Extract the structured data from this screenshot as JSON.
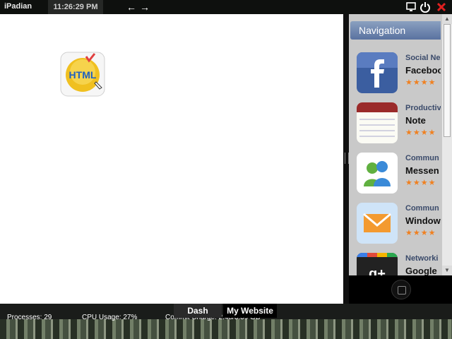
{
  "topbar": {
    "brand": "iPadian",
    "clock": "11:26:29 PM",
    "back_icon": "left-arrow-icon",
    "forward_icon": "right-arrow-icon"
  },
  "desktop": {
    "html_app_label": "HTML"
  },
  "navigation": {
    "title": "Navigation",
    "items": [
      {
        "category": "Social Ne",
        "name": "Faceboo",
        "stars": "★★★★"
      },
      {
        "category": "Productiv",
        "name": "Note",
        "stars": "★★★★"
      },
      {
        "category": "Commun",
        "name": "Messen",
        "stars": "★★★★"
      },
      {
        "category": "Commun",
        "name": "Window",
        "stars": "★★★★"
      },
      {
        "category": "Networki",
        "name": "Google",
        "stars": "★★★★"
      }
    ]
  },
  "taskbar": {
    "dash": "Dash",
    "my_website": "My Website"
  },
  "statusbar": {
    "processes": "Processes: 29",
    "cpu": "CPU Usage: 27%",
    "commit": "Commit Charge: 2.48/3.39 GB"
  },
  "colors": {
    "accent_red": "#e02020",
    "stars": "#f08020"
  }
}
